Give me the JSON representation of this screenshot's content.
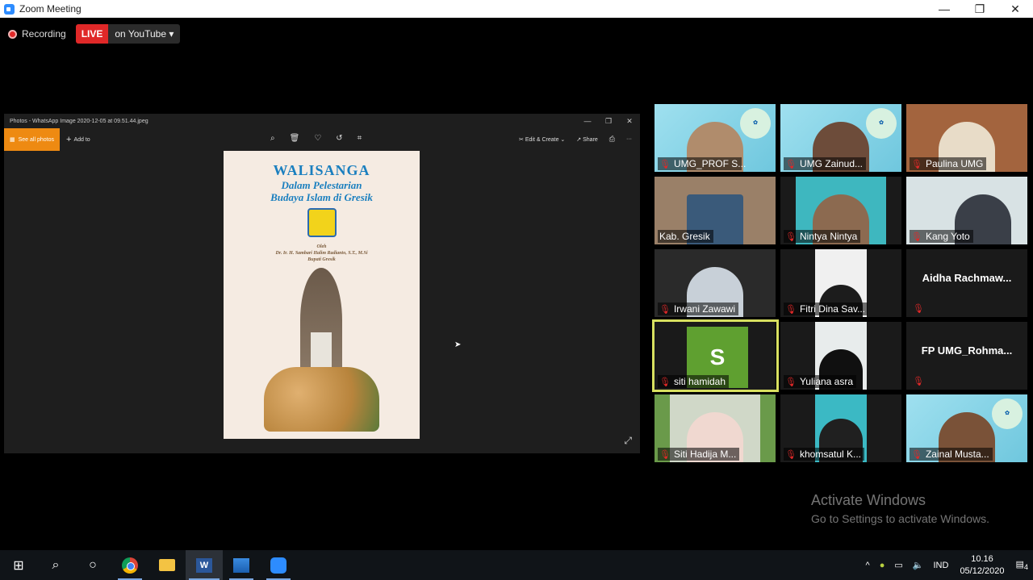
{
  "window": {
    "title": "Zoom Meeting",
    "minimize": "—",
    "restore": "❐",
    "close": "✕"
  },
  "recording": {
    "label": "Recording",
    "live": "LIVE",
    "stream": "on YouTube ▾"
  },
  "photos": {
    "title": "Photos - WhatsApp Image 2020-12-05 at 09.51.44.jpeg",
    "see_all": "See all photos",
    "add_to": "Add to",
    "edit_create": "Edit & Create",
    "share": "Share",
    "book": {
      "title": "WALISANGA",
      "subtitle1": "Dalam Pelestarian",
      "subtitle2": "Budaya Islam di Gresik",
      "oleh": "Oleh",
      "author": "Dr. Ir. H. Sambari Halim Radianto, S.T., M.Si",
      "position": "Bupati Gresik"
    }
  },
  "participants": [
    {
      "name": "UMG_PROF S..."
    },
    {
      "name": "UMG Zainud..."
    },
    {
      "name": "Paulina UMG"
    },
    {
      "name": "Kab. Gresik"
    },
    {
      "name": "Nintya Nintya"
    },
    {
      "name": "Kang Yoto"
    },
    {
      "name": "Irwani Zawawi"
    },
    {
      "name": "Fitri Dina Sav..."
    },
    {
      "name": "Aidha  Rachmaw..."
    },
    {
      "name": "siti hamidah",
      "avatar": "S"
    },
    {
      "name": "Yuliana asra"
    },
    {
      "name": "FP  UMG_Rohma..."
    },
    {
      "name": "Siti Hadija M..."
    },
    {
      "name": "khomsatul K..."
    },
    {
      "name": "Zainal Musta..."
    }
  ],
  "activation": {
    "line1": "Activate Windows",
    "line2": "Go to Settings to activate Windows."
  },
  "taskbar": {
    "lang": "IND",
    "time": "10.16",
    "date": "05/12/2020",
    "notifications": "4"
  },
  "colors": {
    "live_red": "#e02828",
    "accent_orange": "#ee8a12",
    "active_speaker": "#d8e060",
    "zoom_blue": "#2d8cff"
  }
}
